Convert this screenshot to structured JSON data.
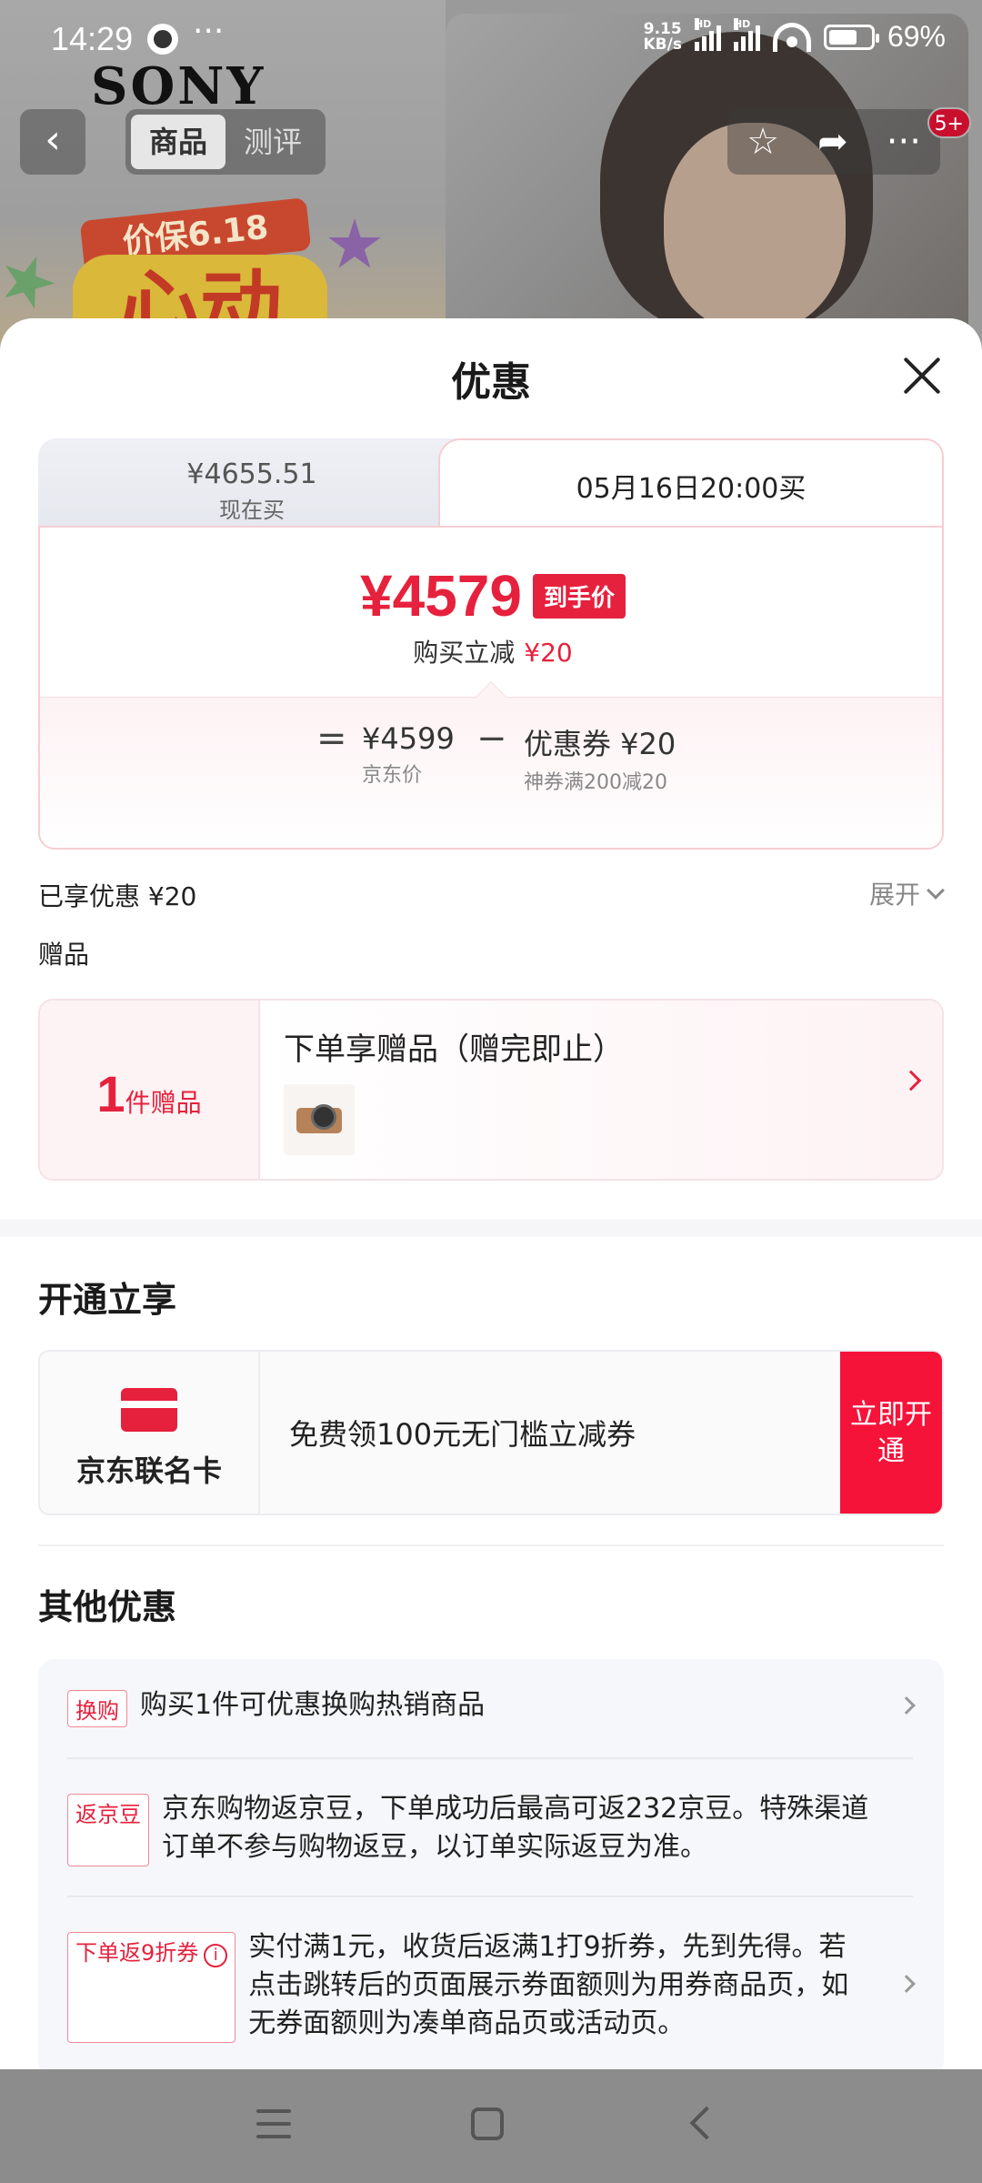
{
  "status_bar": {
    "time": "14:29",
    "more": "···",
    "speed_value": "9.15",
    "speed_unit": "KB/s",
    "hd1": "HD",
    "hd2": "HD",
    "battery": "69%"
  },
  "background": {
    "brand": "SONY",
    "promo_ribbon": "价保6.18",
    "promo_big": "心动",
    "nav_tabs": [
      "商品",
      "测评"
    ],
    "notification_badge": "5+"
  },
  "sheet": {
    "title": "优惠",
    "tabs": {
      "now_price": "¥4655.51",
      "now_label": "现在买",
      "future_label": "05月16日20:00买"
    },
    "final_price": "¥4579",
    "final_tag": "到手价",
    "reduce_label": "购买立减",
    "reduce_value": "¥20",
    "breakdown": {
      "equals": "=",
      "base_value": "¥4599",
      "base_label": "京东价",
      "minus": "−",
      "coupon_value": "优惠券 ¥20",
      "coupon_label": "神券满200减20"
    },
    "enjoyed": "已享优惠 ¥20",
    "expand": "展开",
    "gift_section": "赠品",
    "gift": {
      "count": "1",
      "unit": "件赠品",
      "desc": "下单享赠品（赠完即止）"
    },
    "open_section": "开通立享",
    "card_offer": {
      "name": "京东联名卡",
      "desc": "免费领100元无门槛立减券",
      "button": "立即开通"
    },
    "other_section": "其他优惠",
    "other_items": [
      {
        "tag": "换购",
        "text": "购买1件可优惠换购热销商品"
      },
      {
        "tag": "返京豆",
        "text": "京东购物返京豆，下单成功后最高可返232京豆。特殊渠道订单不参与购物返豆，以订单实际返豆为准。"
      },
      {
        "tag": "下单返9折券",
        "text": "实付满1元，收货后返满1打9折券，先到先得。若点击跳转后的页面展示券面额则为用券商品页，如无券面额则为凑单商品页或活动页。"
      }
    ]
  }
}
